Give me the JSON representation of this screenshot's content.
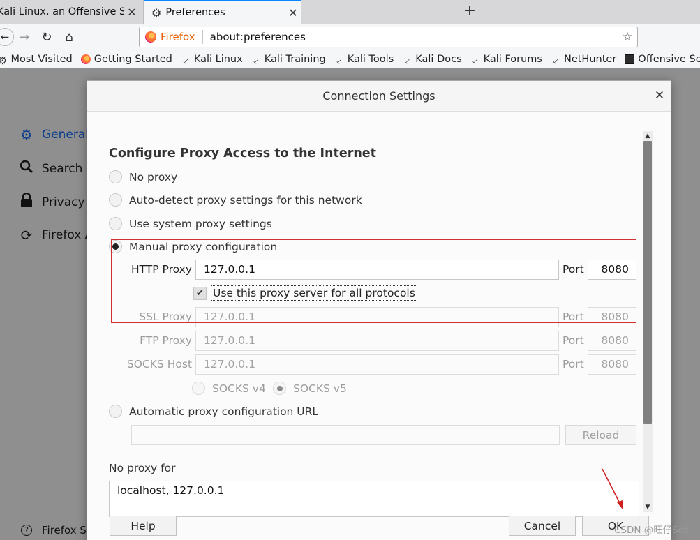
{
  "browser": {
    "tabs": [
      {
        "title": "Kali Linux, an Offensive Security",
        "close": "✕"
      },
      {
        "title": "Preferences",
        "close": "✕"
      }
    ],
    "new_tab": "+",
    "identity": "Firefox",
    "url": "about:preferences",
    "bookmarks": [
      {
        "label": "Most Visited",
        "icon": "gear-icon"
      },
      {
        "label": "Getting Started",
        "icon": "firefox-icon"
      },
      {
        "label": "Kali Linux",
        "icon": "kali-dragon-icon"
      },
      {
        "label": "Kali Training",
        "icon": "kali-dragon-icon"
      },
      {
        "label": "Kali Tools",
        "icon": "kali-dragon-icon"
      },
      {
        "label": "Kali Docs",
        "icon": "kali-dragon-icon"
      },
      {
        "label": "Kali Forums",
        "icon": "kali-dragon-icon"
      },
      {
        "label": "NetHunter",
        "icon": "kali-dragon-icon"
      },
      {
        "label": "Offensive Security",
        "icon": "offsec-icon"
      }
    ]
  },
  "prefs": {
    "categories": [
      {
        "label": "General",
        "icon": "gear-icon"
      },
      {
        "label": "Search",
        "icon": "search-icon"
      },
      {
        "label": "Privacy &",
        "icon": "lock-icon"
      },
      {
        "label": "Firefox A",
        "icon": "sync-icon"
      }
    ],
    "support": "Firefox Su"
  },
  "dialog": {
    "title": "Connection Settings",
    "close": "✕",
    "section_title": "Configure Proxy Access to the Internet",
    "options": {
      "no_proxy": "No proxy",
      "auto_detect": "Auto-detect proxy settings for this network",
      "system": "Use system proxy settings",
      "manual": "Manual proxy configuration",
      "auto_url": "Automatic proxy configuration URL"
    },
    "selected_option": "manual",
    "http_proxy": {
      "label": "HTTP Proxy",
      "value": "127.0.0.1",
      "port_label": "Port",
      "port": "8080"
    },
    "use_for_all": {
      "label": "Use this proxy server for all protocols",
      "checked": true
    },
    "ssl_proxy": {
      "label": "SSL Proxy",
      "value": "127.0.0.1",
      "port_label": "Port",
      "port": "8080"
    },
    "ftp_proxy": {
      "label": "FTP Proxy",
      "value": "127.0.0.1",
      "port_label": "Port",
      "port": "8080"
    },
    "socks_host": {
      "label": "SOCKS Host",
      "value": "127.0.0.1",
      "port_label": "Port",
      "port": "8080"
    },
    "socks_v4": "SOCKS v4",
    "socks_v5": "SOCKS v5",
    "auto_url_value": "",
    "reload": "Reload",
    "no_proxy_for_label": "No proxy for",
    "no_proxy_for_value": "localhost, 127.0.0.1",
    "buttons": {
      "help": "Help",
      "cancel": "Cancel",
      "ok": "OK"
    }
  },
  "watermark": "CSDN @旺仔Sec",
  "colors": {
    "accent": "#0a84ff",
    "highlight": "#d03030",
    "identity": "#e66000"
  }
}
